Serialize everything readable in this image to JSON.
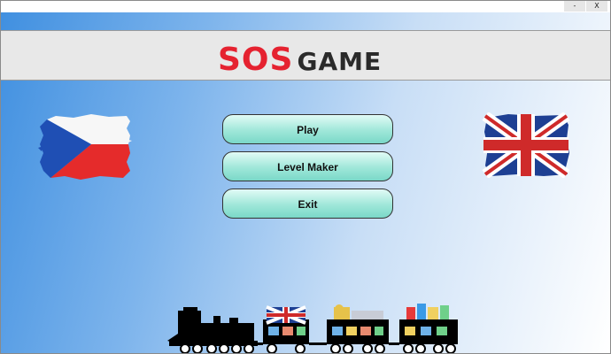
{
  "window": {
    "minimize_label": "-",
    "close_label": "X"
  },
  "header": {
    "logo_part1": "SOS",
    "logo_part2": "GAME"
  },
  "menu": {
    "play_label": "Play",
    "level_maker_label": "Level Maker",
    "exit_label": "Exit"
  },
  "language_flags": [
    "czech-flag",
    "uk-flag"
  ],
  "colors": {
    "logo_red": "#e52230",
    "button_teal": "#9fe7d9",
    "background_blue": "#3f8fe0"
  }
}
